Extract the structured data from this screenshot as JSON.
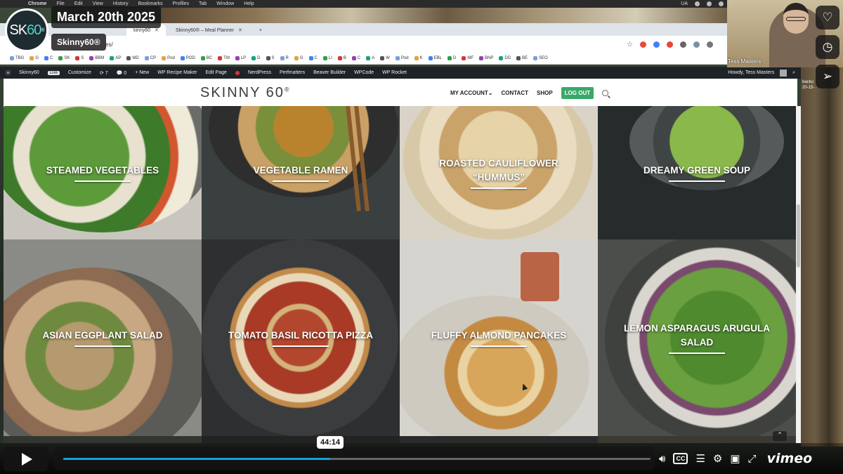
{
  "mac_menu": {
    "app": "Chrome",
    "items": [
      "File",
      "Edit",
      "View",
      "History",
      "Bookmarks",
      "Profiles",
      "Tab",
      "Window",
      "Help"
    ],
    "right": [
      "UA"
    ]
  },
  "browser": {
    "tabs": [
      {
        "label": "kinny60",
        "active": true
      },
      {
        "label": "Skinny60® – Meal Planner",
        "active": false
      }
    ],
    "new_tab": "+",
    "url": "es/",
    "bookmarks": [
      "TBG",
      "G",
      "C",
      "SK",
      "S",
      "BBM",
      "AP",
      "MD",
      "CP",
      "Pod",
      "POD",
      "BC",
      "TM",
      "LP",
      "D",
      "S",
      "R",
      "G",
      "C",
      "LI",
      "B",
      "C",
      "A",
      "W",
      "Pod",
      "K",
      "EBL",
      "D",
      "MF",
      "BNP",
      "DD",
      "BE",
      "SEO"
    ]
  },
  "wp_admin_bar": {
    "site": "Skinny60",
    "live_badge": "Live",
    "items": [
      "Customize",
      "7",
      "0",
      "+ New",
      "WP Recipe Maker",
      "Edit Page",
      "NerdPress",
      "Perfmatters",
      "Beaver Builder",
      "WPCode",
      "WP Rocket"
    ],
    "howdy": "Howdy, Tess Masters"
  },
  "site_header": {
    "logo": "SKINNY 60",
    "logo_mark": "®",
    "nav": [
      "MY ACCOUNT",
      "CONTACT",
      "SHOP"
    ],
    "logout": "LOG OUT"
  },
  "recipes": [
    {
      "title": "STEAMED VEGETABLES"
    },
    {
      "title": "VEGETABLE RAMEN"
    },
    {
      "title": "ROASTED CAULIFLOWER “HUMMUS”"
    },
    {
      "title": "DREAMY GREEN SOUP"
    },
    {
      "title": "ASIAN EGGPLANT SALAD"
    },
    {
      "title": "TOMATO BASIL RICOTTA PIZZA"
    },
    {
      "title": "FLUFFY ALMOND PANCAKES"
    },
    {
      "title": "LEMON ASPARAGUS ARUGULA SALAD"
    }
  ],
  "overlay": {
    "logo_sk": "SK",
    "logo_60": "60",
    "logo_mark": "®",
    "date": "March 20th 2025",
    "name": "Skinny60®"
  },
  "webcam": {
    "name": "Tess Masters"
  },
  "backup_text": [
    "backu",
    "20-15-"
  ],
  "video": {
    "current_time": "44:14",
    "progress_fraction": 0.455,
    "brand": "vimeo",
    "cc_label": "CC"
  }
}
